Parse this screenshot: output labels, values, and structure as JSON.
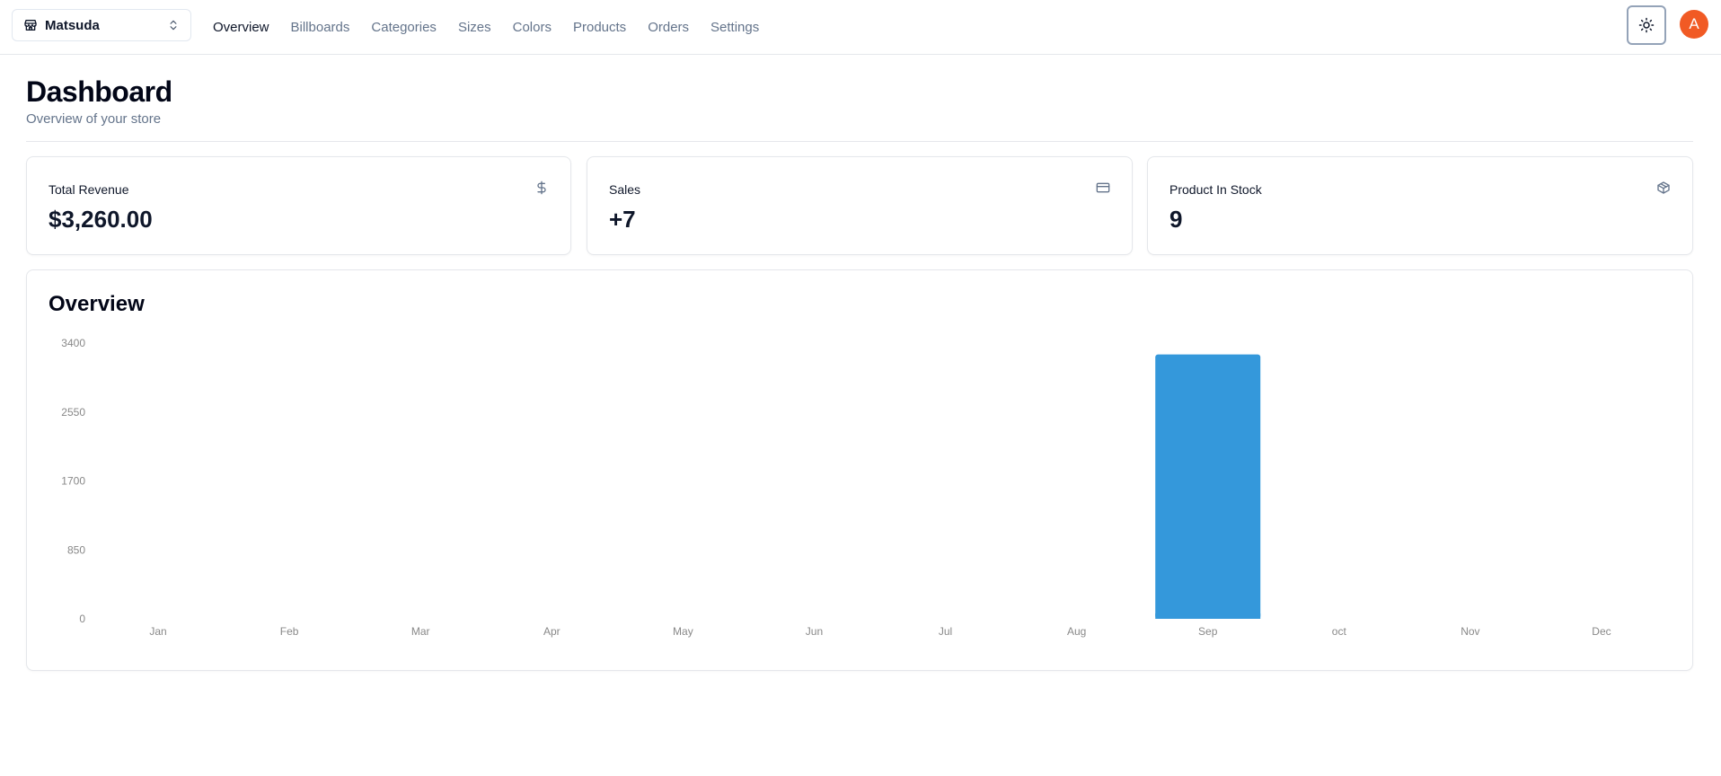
{
  "store": {
    "name": "Matsuda"
  },
  "nav": {
    "items": [
      "Overview",
      "Billboards",
      "Categories",
      "Sizes",
      "Colors",
      "Products",
      "Orders",
      "Settings"
    ],
    "active": "Overview"
  },
  "user": {
    "avatar_initial": "A"
  },
  "header": {
    "title": "Dashboard",
    "subtitle": "Overview of your store"
  },
  "stats": [
    {
      "label": "Total Revenue",
      "value": "$3,260.00",
      "icon": "dollar-icon"
    },
    {
      "label": "Sales",
      "value": "+7",
      "icon": "credit-card-icon"
    },
    {
      "label": "Product In Stock",
      "value": "9",
      "icon": "package-icon"
    }
  ],
  "overview": {
    "title": "Overview"
  },
  "colors": {
    "accent": "#3498db",
    "avatar": "#f15a24"
  },
  "chart_data": {
    "type": "bar",
    "categories": [
      "Jan",
      "Feb",
      "Mar",
      "Apr",
      "May",
      "Jun",
      "Jul",
      "Aug",
      "Sep",
      "oct",
      "Nov",
      "Dec"
    ],
    "values": [
      0,
      0,
      0,
      0,
      0,
      0,
      0,
      0,
      3260,
      0,
      0,
      0
    ],
    "yticks": [
      0,
      850,
      1700,
      2550,
      3400
    ],
    "ylim": [
      0,
      3400
    ],
    "grid": false,
    "bar_color": "#3498db"
  }
}
